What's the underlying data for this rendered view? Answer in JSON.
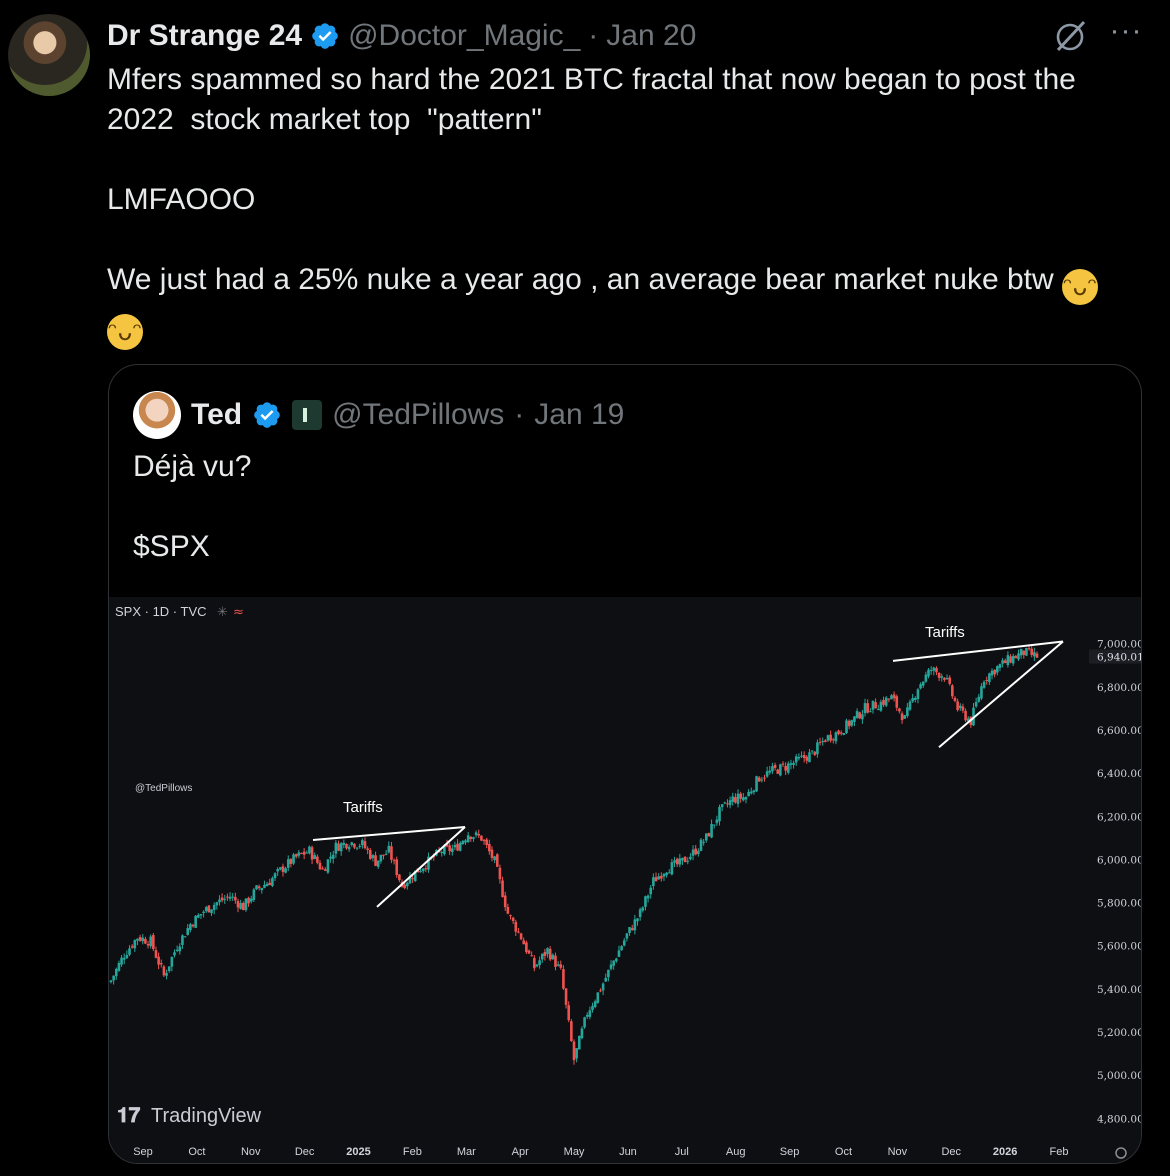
{
  "tweet": {
    "author_name": "Dr Strange 24",
    "handle": "@Doctor_Magic_",
    "separator": "·",
    "date": "Jan 20",
    "more_icon": "more-horizontal-icon",
    "grok_icon": "grok-icon",
    "paragraphs": [
      "Mfers spammed so hard the 2021 BTC fractal that now began to post the 2022  stock market top  \"pattern\"",
      "LMFAOOO",
      "We just had a 25% nuke a year ago , an average bear market nuke btw "
    ],
    "emoji": "😂"
  },
  "quote": {
    "author_name": "Ted",
    "handle": "@TedPillows",
    "separator": "·",
    "date": "Jan 19",
    "paragraphs": [
      "Déjà vu?",
      "$SPX"
    ]
  },
  "chart_data": {
    "type": "candlestick",
    "title": "SPX · 1D · TVC",
    "watermark": "@TedPillows",
    "brand": "TradingView",
    "last_price_label": "6,940.01",
    "y_ticks": [
      "7,000.00",
      "6,800.00",
      "6,600.00",
      "6,400.00",
      "6,200.00",
      "6,000.00",
      "5,800.00",
      "5,600.00",
      "5,400.00",
      "5,200.00",
      "5,000.00",
      "4,800.00"
    ],
    "y_tick_values": [
      7000,
      6800,
      6600,
      6400,
      6200,
      6000,
      5800,
      5600,
      5400,
      5200,
      5000,
      4800
    ],
    "x_ticks": [
      "Sep",
      "Oct",
      "Nov",
      "Dec",
      "2025",
      "Feb",
      "Mar",
      "Apr",
      "May",
      "Jun",
      "Jul",
      "Aug",
      "Sep",
      "Oct",
      "Nov",
      "Dec",
      "2026",
      "Feb"
    ],
    "bold_x_ticks": [
      "2025",
      "2026"
    ],
    "ylim": [
      4760,
      7040
    ],
    "up_color": "#26a69a",
    "down_color": "#ef5350",
    "series_close": [
      5440,
      5560,
      5640,
      5620,
      5460,
      5600,
      5700,
      5760,
      5800,
      5830,
      5780,
      5860,
      5900,
      5960,
      6010,
      6040,
      5950,
      6060,
      6080,
      6070,
      5990,
      6040,
      5880,
      5940,
      5990,
      6040,
      6050,
      6120,
      6100,
      5990,
      5750,
      5640,
      5500,
      5580,
      5480,
      5070,
      5290,
      5400,
      5530,
      5650,
      5750,
      5900,
      5960,
      5980,
      6030,
      6100,
      6220,
      6280,
      6290,
      6380,
      6410,
      6430,
      6460,
      6490,
      6560,
      6590,
      6640,
      6700,
      6720,
      6750,
      6650,
      6800,
      6880,
      6850,
      6700,
      6640,
      6840,
      6890,
      6930,
      6960,
      6940
    ],
    "annotations": [
      {
        "text": "Tariffs",
        "period": "Dec 2024 – Feb 2025",
        "shape": "rising wedge"
      },
      {
        "text": "Tariffs",
        "period": "Oct 2025 – Jan 2026",
        "shape": "rising wedge"
      }
    ]
  }
}
